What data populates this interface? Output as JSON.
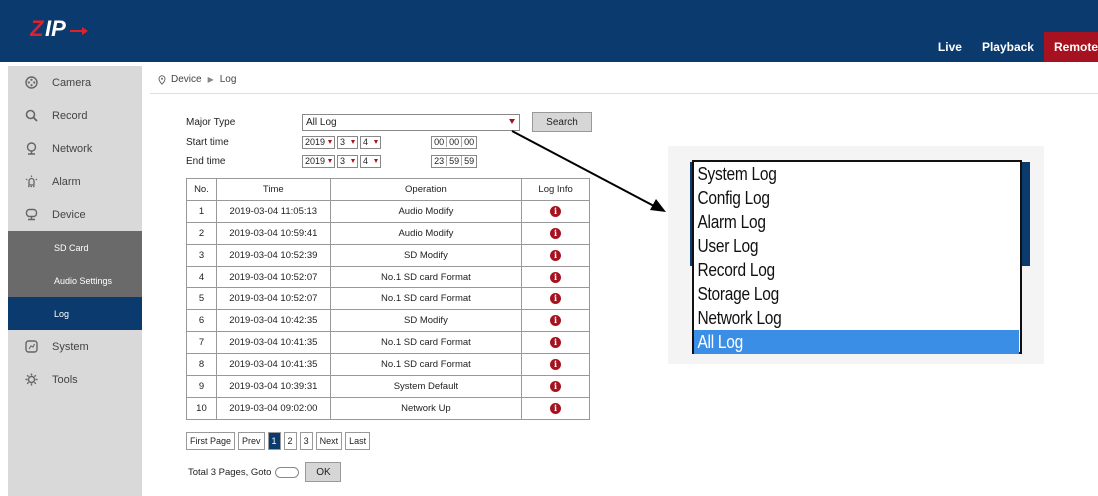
{
  "header": {
    "logo_text": "ZIP",
    "nav": [
      "Live",
      "Playback",
      "Remote"
    ],
    "brand_color": "#0b3a6e",
    "accent_color": "#a6121f"
  },
  "sidebar": {
    "items": [
      {
        "label": "Camera",
        "icon": "camera-icon"
      },
      {
        "label": "Record",
        "icon": "search-icon"
      },
      {
        "label": "Network",
        "icon": "network-icon"
      },
      {
        "label": "Alarm",
        "icon": "alarm-icon"
      },
      {
        "label": "Device",
        "icon": "device-icon"
      },
      {
        "label": "System",
        "icon": "system-icon"
      },
      {
        "label": "Tools",
        "icon": "tools-icon"
      }
    ],
    "device_sub": [
      "SD Card",
      "Audio Settings",
      "Log"
    ]
  },
  "breadcrumb": {
    "root": "Device",
    "leaf": "Log"
  },
  "form": {
    "major_type_label": "Major Type",
    "major_type_value": "All Log",
    "search_label": "Search",
    "start_label": "Start time",
    "end_label": "End time",
    "start": {
      "year": "2019",
      "month": "3",
      "day": "4",
      "h": "00",
      "m": "00",
      "s": "00"
    },
    "end": {
      "year": "2019",
      "month": "3",
      "day": "4",
      "h": "23",
      "m": "59",
      "s": "59"
    }
  },
  "table": {
    "headers": [
      "No.",
      "Time",
      "Operation",
      "Log Info"
    ],
    "rows": [
      {
        "no": "1",
        "time": "2019-03-04 11:05:13",
        "op": "Audio Modify"
      },
      {
        "no": "2",
        "time": "2019-03-04 10:59:41",
        "op": "Audio Modify"
      },
      {
        "no": "3",
        "time": "2019-03-04 10:52:39",
        "op": "SD Modify"
      },
      {
        "no": "4",
        "time": "2019-03-04 10:52:07",
        "op": "No.1 SD card Format"
      },
      {
        "no": "5",
        "time": "2019-03-04 10:52:07",
        "op": "No.1 SD card Format"
      },
      {
        "no": "6",
        "time": "2019-03-04 10:42:35",
        "op": "SD Modify"
      },
      {
        "no": "7",
        "time": "2019-03-04 10:41:35",
        "op": "No.1 SD card Format"
      },
      {
        "no": "8",
        "time": "2019-03-04 10:41:35",
        "op": "No.1 SD card Format"
      },
      {
        "no": "9",
        "time": "2019-03-04 10:39:31",
        "op": "System Default"
      },
      {
        "no": "10",
        "time": "2019-03-04 09:02:00",
        "op": "Network Up"
      }
    ],
    "info_glyph": "i"
  },
  "pager": {
    "first": "First Page",
    "prev": "Prev",
    "pages": [
      "1",
      "2",
      "3"
    ],
    "next": "Next",
    "last": "Last",
    "total_text": "Total 3 Pages, Goto",
    "ok": "OK"
  },
  "dropdown_options": [
    "System Log",
    "Config Log",
    "Alarm Log",
    "User Log",
    "Record Log",
    "Storage Log",
    "Network Log",
    "All Log"
  ],
  "dropdown_selected": "All Log"
}
